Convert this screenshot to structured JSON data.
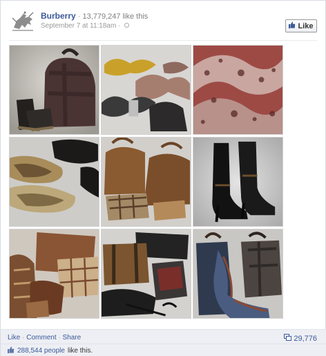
{
  "post": {
    "page_name": "Burberry",
    "separator": " · ",
    "like_count": "13,779,247 like this",
    "timestamp": "September 7 at 11:18am",
    "meta_separator": " · ",
    "privacy_icon": "globe-icon",
    "logo_icon": "burberry-knight-logo"
  },
  "like_button": {
    "label": "Like",
    "icon": "thumbs-up-icon"
  },
  "photos": [
    {
      "subject": "burgundy handbag and heeled sandals"
    },
    {
      "subject": "yellow, grey and black bow ties"
    },
    {
      "subject": "animal print scarf"
    },
    {
      "subject": "metallic ballet flats"
    },
    {
      "subject": "tan leather bags and check accessories"
    },
    {
      "subject": "black leather ankle boots"
    },
    {
      "subject": "tan leather pouches and scarves"
    },
    {
      "subject": "leather messenger bags and umbrella"
    },
    {
      "subject": "tote bags and check scarf"
    }
  ],
  "actions": {
    "like": "Like",
    "dot": " · ",
    "comment": "Comment",
    "share": "Share",
    "share_count": "29,776",
    "share_icon": "shares-icon"
  },
  "likes_summary": {
    "icon": "thumbs-up-icon",
    "count": "288,544 people",
    "suffix": "like this."
  },
  "colors": {
    "link": "#3b5998",
    "meta": "#999999",
    "footer_bg": "#edeff4"
  }
}
